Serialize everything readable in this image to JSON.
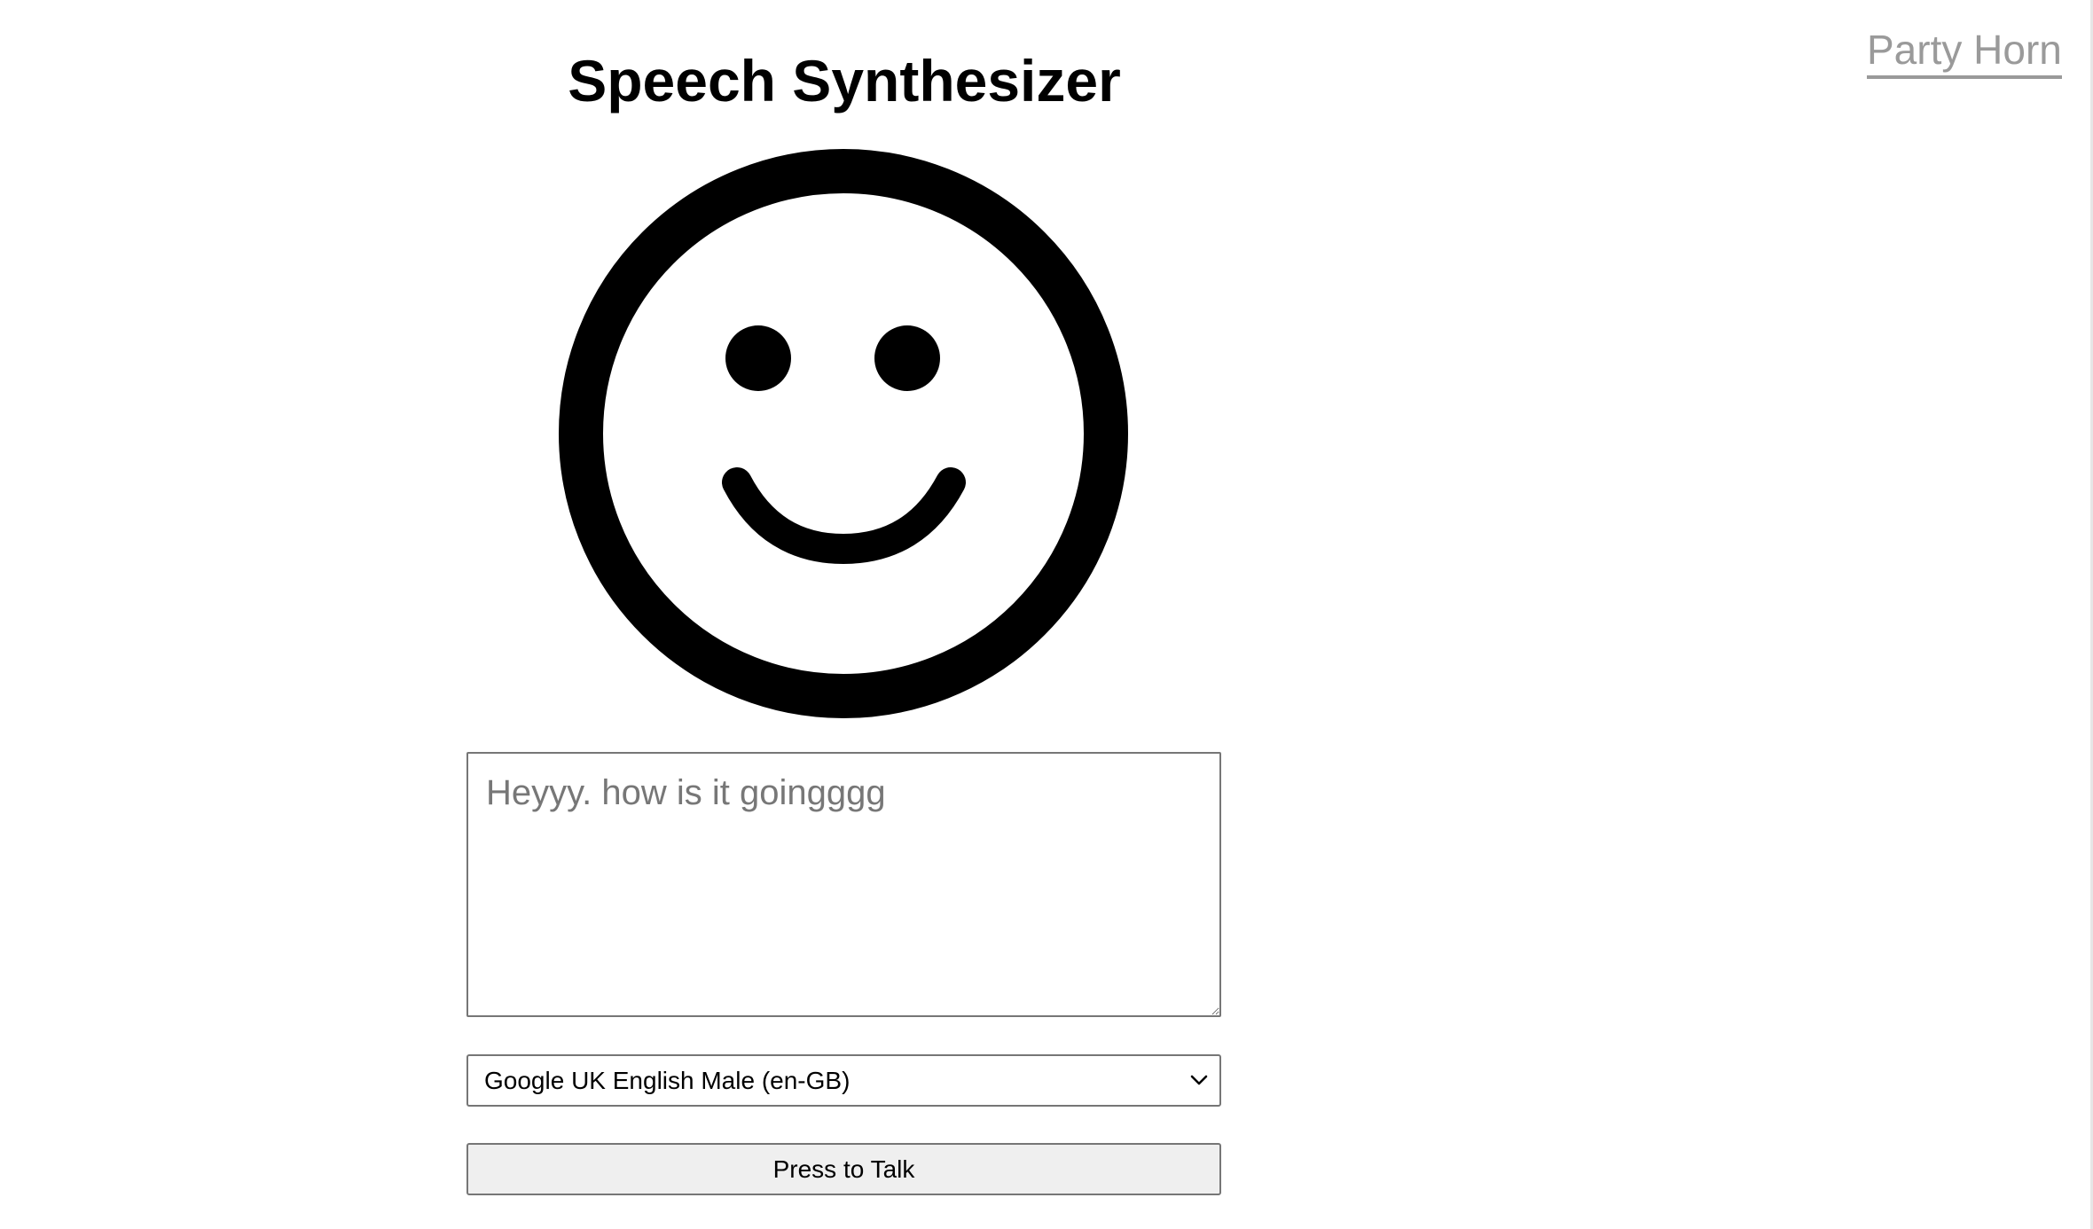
{
  "nav": {
    "link_label": "Party Horn"
  },
  "header": {
    "title": "Speech Synthesizer"
  },
  "face": {
    "expression": "smiling",
    "icon": "smiley-face-icon",
    "color": "#000000"
  },
  "text_input": {
    "value": "",
    "placeholder": "Heyyy. how is it goingggg"
  },
  "voice_select": {
    "selected": "Google UK English Male (en-GB)"
  },
  "talk_button": {
    "label": "Press to Talk"
  },
  "colors": {
    "link": "#9a9a9a",
    "button_bg": "#efefef",
    "border": "#767676"
  }
}
